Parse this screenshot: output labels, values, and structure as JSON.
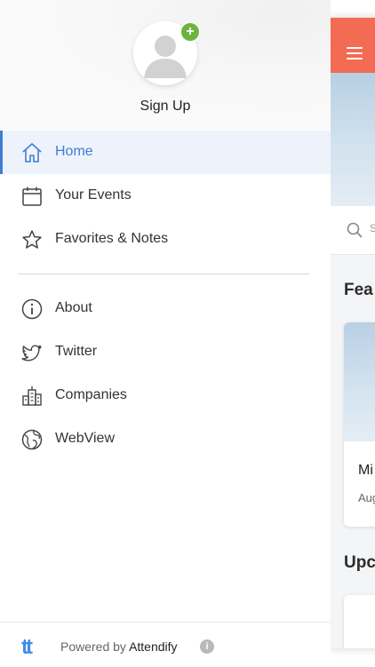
{
  "colors": {
    "accent": "#3f7dd6",
    "topbar": "#f26b52",
    "plus_badge": "#6db33f"
  },
  "profile": {
    "signup_label": "Sign Up",
    "avatar_icon": "user-avatar-icon",
    "badge_icon": "plus-icon"
  },
  "nav": {
    "primary": [
      {
        "label": "Home",
        "icon": "home-icon",
        "active": true
      },
      {
        "label": "Your Events",
        "icon": "calendar-icon",
        "active": false
      },
      {
        "label": "Favorites & Notes",
        "icon": "star-icon",
        "active": false
      }
    ],
    "secondary": [
      {
        "label": "About",
        "icon": "info-icon"
      },
      {
        "label": "Twitter",
        "icon": "twitter-icon"
      },
      {
        "label": "Companies",
        "icon": "buildings-icon"
      },
      {
        "label": "WebView",
        "icon": "globe-icon"
      }
    ]
  },
  "footer": {
    "powered_by": "Powered by",
    "brand": "Attendify",
    "logo_text": "tt"
  },
  "background_app": {
    "search_placeholder": "S",
    "section_featured": "Fea",
    "card_title": "Mi",
    "card_date": "Aug",
    "section_upcoming": "Upc"
  }
}
